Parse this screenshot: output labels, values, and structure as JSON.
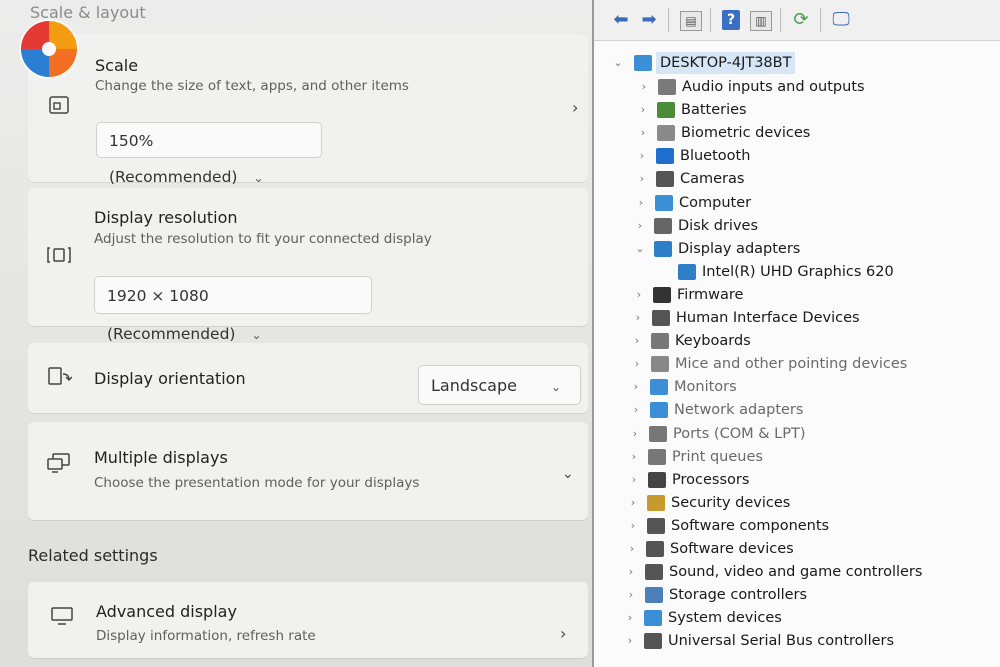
{
  "settings": {
    "section_title": "Scale & layout",
    "scale": {
      "title": "Scale",
      "description": "Change the size of text, apps, and other items",
      "value": "150% (Recommended)"
    },
    "resolution": {
      "title": "Display resolution",
      "description": "Adjust the resolution to fit your connected display",
      "value": "1920 × 1080 (Recommended)"
    },
    "orientation": {
      "title": "Display orientation",
      "value": "Landscape"
    },
    "multiple": {
      "title": "Multiple displays",
      "description": "Choose the presentation mode for your displays"
    },
    "related_title": "Related settings",
    "advanced": {
      "title": "Advanced display",
      "description": "Display information, refresh rate"
    }
  },
  "device_manager": {
    "computer_name": "DESKTOP-4JT38BT",
    "categories": [
      {
        "label": "Audio inputs and outputs",
        "expanded": false,
        "color": "#7a7a7a"
      },
      {
        "label": "Batteries",
        "expanded": false,
        "color": "#4c8b3a"
      },
      {
        "label": "Biometric devices",
        "expanded": false,
        "color": "#8a8a8a"
      },
      {
        "label": "Bluetooth",
        "expanded": false,
        "color": "#1f6fd1"
      },
      {
        "label": "Cameras",
        "expanded": false,
        "color": "#555555"
      },
      {
        "label": "Computer",
        "expanded": false,
        "color": "#3a8fd6"
      },
      {
        "label": "Disk drives",
        "expanded": false,
        "color": "#666666"
      },
      {
        "label": "Display adapters",
        "expanded": true,
        "color": "#2f7fc6"
      },
      {
        "label": "Intel(R) UHD Graphics 620",
        "child": true,
        "color": "#2f7fc6"
      },
      {
        "label": "Firmware",
        "expanded": false,
        "color": "#333333"
      },
      {
        "label": "Human Interface Devices",
        "expanded": false,
        "color": "#555555"
      },
      {
        "label": "Keyboards",
        "expanded": false,
        "color": "#777777"
      },
      {
        "label": "Mice and other pointing devices",
        "expanded": false,
        "color": "#888888"
      },
      {
        "label": "Monitors",
        "expanded": false,
        "color": "#3a8fd6"
      },
      {
        "label": "Network adapters",
        "expanded": false,
        "color": "#3a8fd6"
      },
      {
        "label": "Ports (COM & LPT)",
        "expanded": false,
        "color": "#777777"
      },
      {
        "label": "Print queues",
        "expanded": false,
        "color": "#777777"
      },
      {
        "label": "Processors",
        "expanded": false,
        "color": "#444444"
      },
      {
        "label": "Security devices",
        "expanded": false,
        "color": "#c89a2e"
      },
      {
        "label": "Software components",
        "expanded": false,
        "color": "#555555"
      },
      {
        "label": "Software devices",
        "expanded": false,
        "color": "#555555"
      },
      {
        "label": "Sound, video and game controllers",
        "expanded": false,
        "color": "#555555"
      },
      {
        "label": "Storage controllers",
        "expanded": false,
        "color": "#4a7fb8"
      },
      {
        "label": "System devices",
        "expanded": false,
        "color": "#3a8fd6"
      },
      {
        "label": "Universal Serial Bus controllers",
        "expanded": false,
        "color": "#555555"
      }
    ]
  }
}
